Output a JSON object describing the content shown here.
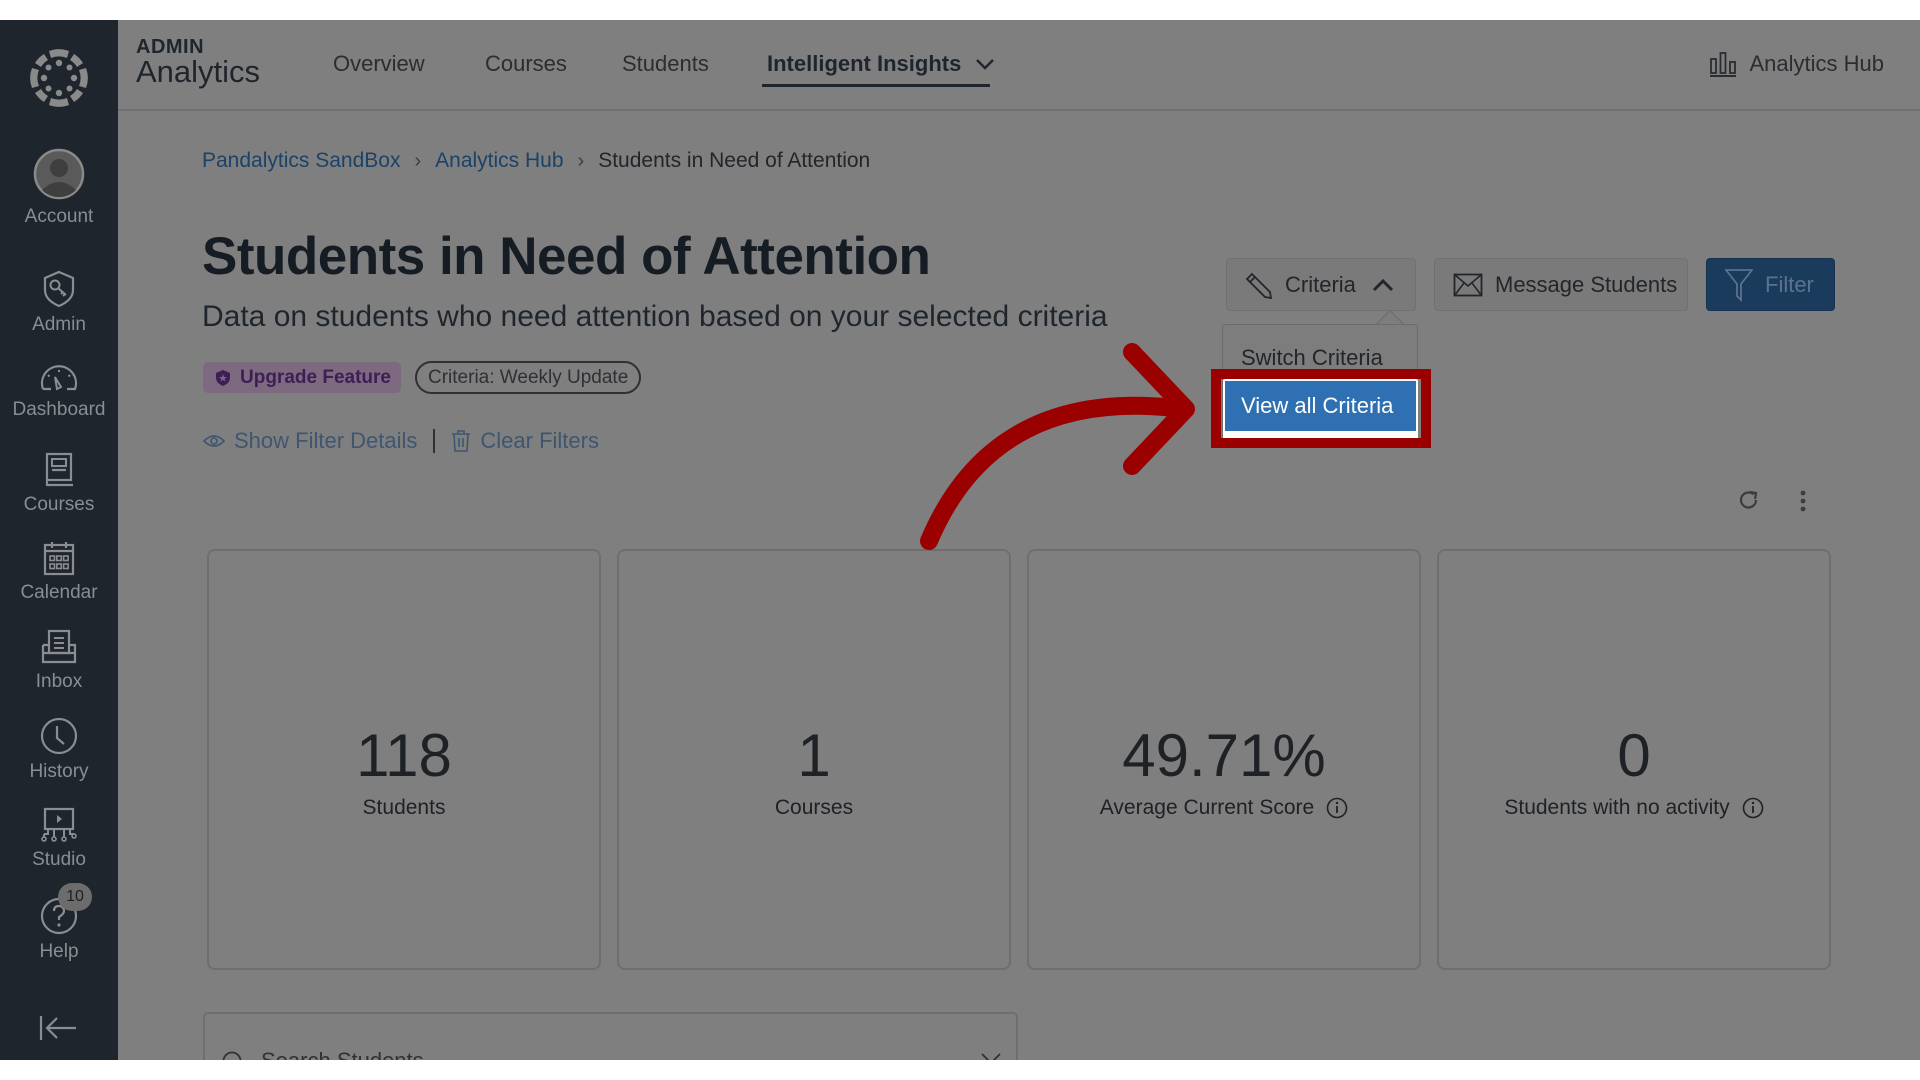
{
  "sidebar": {
    "logo": "canvas-logo-icon",
    "items": [
      {
        "label": "Account",
        "icon": "avatar-icon"
      },
      {
        "label": "Admin",
        "icon": "shield-key-icon"
      },
      {
        "label": "Dashboard",
        "icon": "speedometer-icon"
      },
      {
        "label": "Courses",
        "icon": "book-icon"
      },
      {
        "label": "Calendar",
        "icon": "calendar-icon"
      },
      {
        "label": "Inbox",
        "icon": "inbox-icon"
      },
      {
        "label": "History",
        "icon": "clock-icon"
      },
      {
        "label": "Studio",
        "icon": "studio-icon"
      },
      {
        "label": "Help",
        "icon": "help-icon",
        "badge": "10"
      }
    ],
    "collapse_icon": "collapse-left-icon"
  },
  "header": {
    "app_subtitle": "ADMIN",
    "app_title": "Analytics",
    "tabs": [
      {
        "label": "Overview",
        "active": false
      },
      {
        "label": "Courses",
        "active": false
      },
      {
        "label": "Students",
        "active": false
      },
      {
        "label": "Intelligent Insights",
        "active": true
      }
    ],
    "hub_link": "Analytics Hub"
  },
  "breadcrumb": [
    {
      "label": "Pandalytics SandBox",
      "link": true
    },
    {
      "label": "Analytics Hub",
      "link": true
    },
    {
      "label": "Students in Need of Attention",
      "link": false
    }
  ],
  "page": {
    "title": "Students in Need of Attention",
    "subtitle": "Data on students who need attention based on your selected criteria",
    "upgrade_badge": "Upgrade Feature",
    "criteria_badge": "Criteria: Weekly Update",
    "show_filter_details": "Show Filter Details",
    "clear_filters": "Clear Filters"
  },
  "actions": {
    "criteria": "Criteria",
    "message_students": "Message Students",
    "filter": "Filter"
  },
  "criteria_menu": {
    "items": [
      "Switch Criteria",
      "View all Criteria"
    ],
    "highlighted": "View all Criteria"
  },
  "annotation": {
    "type": "arrow",
    "color": "#9b0000",
    "target": "View all Criteria"
  },
  "cards": [
    {
      "value": "118",
      "label": "Students",
      "info": false
    },
    {
      "value": "1",
      "label": "Courses",
      "info": false
    },
    {
      "value": "49.71%",
      "label": "Average Current Score",
      "info": true
    },
    {
      "value": "0",
      "label": "Students with no activity",
      "info": true
    }
  ],
  "search": {
    "placeholder": "Search Students"
  },
  "colors": {
    "sidebar": "#1f252d",
    "primary_button": "#2e70b2",
    "upgrade": "#3e1e54",
    "highlight": "#9b0000"
  }
}
